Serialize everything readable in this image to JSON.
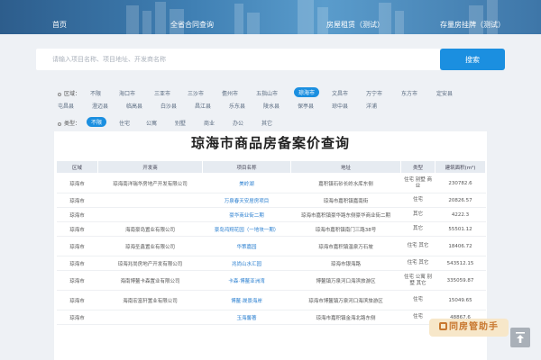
{
  "nav": {
    "home": "首页",
    "contract_query": "全省合同查询",
    "rental": "房屋租赁（测试）",
    "stock_listing": "存量房挂牌（测试）"
  },
  "search": {
    "placeholder": "请输入项目名称、项目地址、开发商名称",
    "button": "搜索"
  },
  "filters": {
    "region_label": "区域：",
    "regions_row1": [
      "不限",
      "海口市",
      "三亚市",
      "三沙市",
      "儋州市",
      "五指山市",
      "琼海市",
      "文昌市",
      "万宁市",
      "东方市",
      "定安县"
    ],
    "regions_row2": [
      "屯昌县",
      "澄迈县",
      "临高县",
      "白沙县",
      "昌江县",
      "乐东县",
      "陵水县",
      "保亭县",
      "琼中县",
      "洋浦"
    ],
    "active_region": "琼海市",
    "type_label": "类型：",
    "types": [
      "不限",
      "住宅",
      "公寓",
      "别墅",
      "商业",
      "办公",
      "其它"
    ],
    "active_type": "不限"
  },
  "page_title": "琼海市商品房备案价查询",
  "table": {
    "headers": [
      "区域",
      "开发商",
      "项目名称",
      "地址",
      "类型",
      "建筑面积(m²)"
    ],
    "rows": [
      {
        "region": "琼海市",
        "developer": "琼海南洋瑞华房地产开发有限公司",
        "project": "美岭湖",
        "address": "嘉积镇石砂长岭水库东侧",
        "type": "住宅 别墅 商业",
        "area": "230782.6"
      },
      {
        "region": "琼海市",
        "developer": "",
        "project": "万泉春天安居房项目",
        "address": "琼海市嘉积镇嘉南街",
        "type": "住宅",
        "area": "20826.57"
      },
      {
        "region": "琼海市",
        "developer": "",
        "project": "豪华商业街二期",
        "address": "琼海市嘉积镇豪华路东侧豪华商业街二期",
        "type": "其它",
        "area": "4222.3"
      },
      {
        "region": "琼海市",
        "developer": "海南豪岛置业有限公司",
        "project": "豪岛鸿翔花园（一地块一期）",
        "address": "琼海市嘉积镇南门三路38号",
        "type": "其它",
        "area": "55501.12"
      },
      {
        "region": "琼海市",
        "developer": "琼海圣鑫置业有限公司",
        "project": "华策嘉园",
        "address": "琼海市嘉积镇温泉万石坡",
        "type": "住宅 其它",
        "area": "18406.72"
      },
      {
        "region": "琼海市",
        "developer": "琼海兆尚房地产开发有限公司",
        "project": "兆尚山水汇园",
        "address": "琼海市银海路",
        "type": "住宅 其它",
        "area": "543512.15"
      },
      {
        "region": "琼海市",
        "developer": "海南博鳌卡森置业有限公司",
        "project": "卡森·博鳌亚洲湾",
        "address": "博鳌镇万泉河口海滨旅游区",
        "type": "住宅 公寓 别墅 其它",
        "area": "335059.87"
      },
      {
        "region": "琼海市",
        "developer": "海南宏富轩置业有限公司",
        "project": "博鳌·晟景海岸",
        "address": "琼海市博鳌镇万泉河口海滨旅游区",
        "type": "住宅",
        "area": "15049.65"
      },
      {
        "region": "琼海市",
        "developer": "",
        "project": "玉海馨著",
        "address": "琼海市嘉积镇金海北路东侧",
        "type": "住宅",
        "area": "48867.6"
      }
    ]
  },
  "helper_badge": "同房管助手"
}
